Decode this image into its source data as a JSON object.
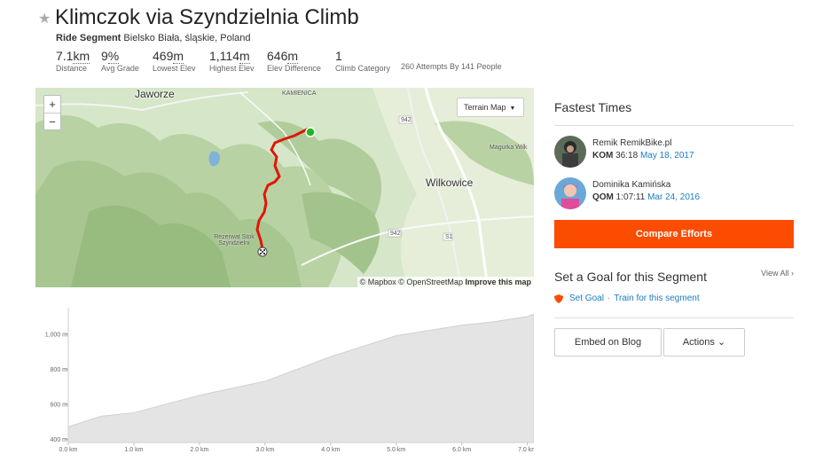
{
  "header": {
    "title": "Klimczok via Szyndzielnia Climb",
    "type_label": "Ride Segment",
    "location": "Bielsko Biała, śląskie, Poland",
    "attempts": "260 Attempts By 141 People"
  },
  "stats": [
    {
      "value": "7.1",
      "unit": "km",
      "label": "Distance"
    },
    {
      "value": "9",
      "unit": "%",
      "label": "Avg Grade"
    },
    {
      "value": "469",
      "unit": "m",
      "label": "Lowest Elev"
    },
    {
      "value": "1,114",
      "unit": "m",
      "label": "Highest Elev"
    },
    {
      "value": "646",
      "unit": "m",
      "label": "Elev Difference"
    },
    {
      "value": "1",
      "unit": "",
      "label": "Climb Category"
    }
  ],
  "map": {
    "zoom_in": "+",
    "zoom_out": "−",
    "style_button": "Terrain Map",
    "labels": {
      "jaworze": "Jaworze",
      "kamienica": "KAMIENICA",
      "wilkowice": "Wilkowice",
      "magurka": "Magurka Wilk",
      "rezerwat": "Rezerwat Stok Szyndzielni",
      "road_942a": "942",
      "road_942b": "942",
      "road_s1": "S1"
    },
    "attribution": "© Mapbox © OpenStreetMap",
    "improve": "Improve this map"
  },
  "elevation": {
    "y_ticks": [
      "1,000 m",
      "800 m",
      "600 m",
      "400 m"
    ],
    "x_ticks": [
      "0.0 km",
      "1.0 km",
      "2.0 km",
      "3.0 km",
      "4.0 km",
      "5.0 km",
      "6.0 km",
      "7.0 km"
    ],
    "profile_km": [
      0,
      0.5,
      1.0,
      1.5,
      2.0,
      2.5,
      3.0,
      3.5,
      4.0,
      4.5,
      5.0,
      5.5,
      6.0,
      6.5,
      7.0,
      7.1
    ],
    "profile_m": [
      470,
      530,
      550,
      600,
      650,
      690,
      730,
      800,
      870,
      930,
      990,
      1020,
      1050,
      1070,
      1100,
      1114
    ]
  },
  "fastest": {
    "heading": "Fastest Times",
    "leaders": [
      {
        "name": "Remik RemikBike.pl",
        "badge": "KOM",
        "time": "36:18",
        "date": "May 18, 2017"
      },
      {
        "name": "Dominika Kamińska",
        "badge": "QOM",
        "time": "1:07:11",
        "date": "Mar 24, 2016"
      }
    ],
    "compare_button": "Compare Efforts"
  },
  "goal": {
    "heading": "Set a Goal for this Segment",
    "view_all": "View All",
    "set_goal": "Set Goal",
    "separator": "·",
    "train": "Train for this segment"
  },
  "buttons": {
    "embed": "Embed on Blog",
    "actions": "Actions"
  },
  "colors": {
    "brand": "#fc4c02",
    "link": "#1b7dc0",
    "route": "#e1140a",
    "start": "#1fb71f"
  }
}
